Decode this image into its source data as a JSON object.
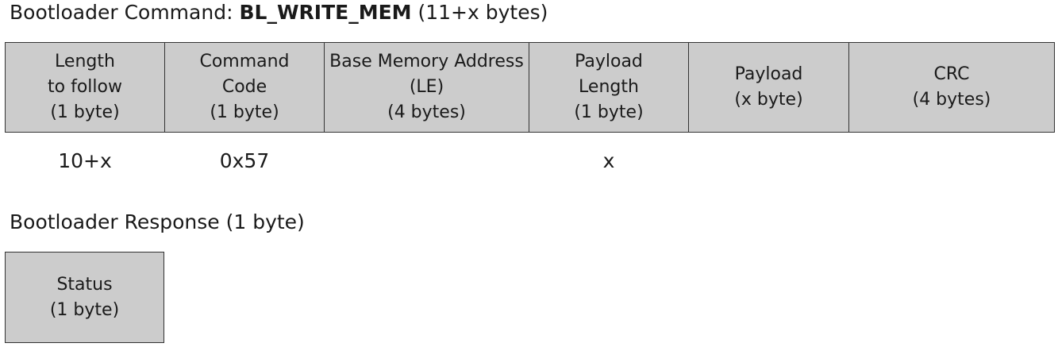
{
  "command_heading": {
    "prefix": "Bootloader Command: ",
    "name": "BL_WRITE_MEM",
    "suffix": " (11+x bytes)"
  },
  "fields": [
    {
      "lines": [
        "Length",
        "to follow",
        "(1 byte)"
      ],
      "value": "10+x"
    },
    {
      "lines": [
        "Command",
        "Code",
        "(1 byte)"
      ],
      "value": "0x57"
    },
    {
      "lines": [
        "Base Memory Address",
        "(LE)",
        "(4 bytes)"
      ],
      "value": ""
    },
    {
      "lines": [
        "Payload",
        "Length",
        "(1 byte)"
      ],
      "value": "x"
    },
    {
      "lines": [
        "Payload",
        "(x byte)"
      ],
      "value": ""
    },
    {
      "lines": [
        "CRC",
        "(4 bytes)"
      ],
      "value": ""
    }
  ],
  "response_heading": "Bootloader Response (1 byte)",
  "response_fields": [
    {
      "lines": [
        "Status",
        "(1 byte)"
      ]
    }
  ],
  "colors": {
    "cell_fill": "#cccccc",
    "cell_border": "#333333",
    "text": "#1a1a1a"
  }
}
